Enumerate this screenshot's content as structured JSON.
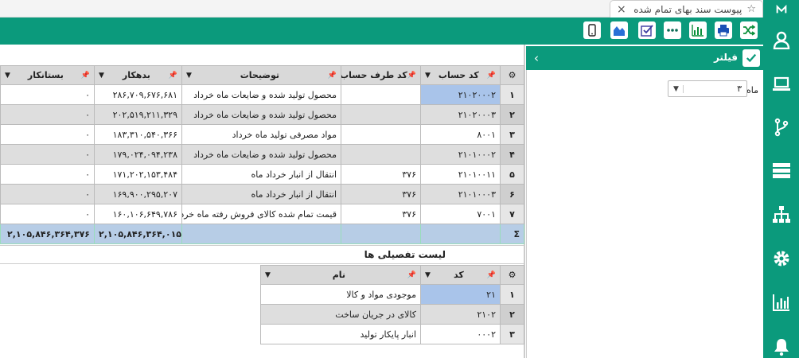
{
  "tab": {
    "title": "پیوست سند بهای تمام شده",
    "close": "×",
    "star": "☆"
  },
  "filter": {
    "title": "فیلتر",
    "chevron": "‹",
    "month_label": "ماه",
    "month_value": "۳"
  },
  "main_table": {
    "headers": {
      "account": "کد حساب",
      "counter": "کد طرف حساب",
      "desc": "توضیحات",
      "debit": "بدهکار",
      "credit": "بستانکار"
    },
    "rows": [
      {
        "idx": "۱",
        "account": "۲۱۰۲۰۰۰۲",
        "counter": "",
        "desc": "محصول تولید شده و ضایعات ماه خرداد",
        "debit": "۲۸۶,۷۰۹,۶۷۶,۶۸۱",
        "credit": "۰"
      },
      {
        "idx": "۲",
        "account": "۲۱۰۲۰۰۰۳",
        "counter": "",
        "desc": "محصول تولید شده و ضایعات ماه خرداد",
        "debit": "۲۰۲,۵۱۹,۲۱۱,۳۲۹",
        "credit": "۰"
      },
      {
        "idx": "۳",
        "account": "۸۰۰۱",
        "counter": "",
        "desc": "مواد مصرفی تولید ماه خرداد",
        "debit": "۱۸۳,۳۱۰,۵۴۰,۳۶۶",
        "credit": "۰"
      },
      {
        "idx": "۴",
        "account": "۲۱۰۱۰۰۰۲",
        "counter": "",
        "desc": "محصول تولید شده و ضایعات ماه خرداد",
        "debit": "۱۷۹,۰۲۴,۰۹۴,۲۳۸",
        "credit": "۰"
      },
      {
        "idx": "۵",
        "account": "۲۱۰۱۰۰۱۱",
        "counter": "۳۷۶",
        "desc": "انتقال از انبار خرداد ماه",
        "debit": "۱۷۱,۲۰۲,۱۵۳,۴۸۴",
        "credit": "۰"
      },
      {
        "idx": "۶",
        "account": "۲۱۰۱۰۰۰۳",
        "counter": "۳۷۶",
        "desc": "انتقال از انبار خرداد ماه",
        "debit": "۱۶۹,۹۰۰,۲۹۵,۲۰۷",
        "credit": "۰"
      },
      {
        "idx": "۷",
        "account": "۷۰۰۱",
        "counter": "۳۷۶",
        "desc": "قیمت تمام شده کالای فروش رفته ماه خرد",
        "debit": "۱۶۰,۱۰۶,۶۴۹,۷۸۶",
        "credit": "۰"
      }
    ],
    "sum": {
      "symbol": "Σ",
      "debit": "۲,۱۰۵,۸۴۶,۳۶۴,۰۱۵",
      "credit": "۲,۱۰۵,۸۴۶,۳۶۴,۳۷۶"
    }
  },
  "detail": {
    "title": "لیست تفصیلی ها",
    "headers": {
      "code": "کد",
      "name": "نام"
    },
    "rows": [
      {
        "idx": "۱",
        "code": "۲۱",
        "name": "موجودی مواد و کالا"
      },
      {
        "idx": "۲",
        "code": "۲۱۰۲",
        "name": "کالای در جریان ساخت"
      },
      {
        "idx": "۳",
        "code": "۰۰۰۲",
        "name": "انبار پایکار تولید"
      }
    ]
  },
  "icons": {
    "nav": [
      "logo-icon",
      "user-icon",
      "laptop-icon",
      "branch-icon",
      "server-icon",
      "sitemap-icon",
      "gear-icon",
      "bar-chart-icon",
      "bell-icon"
    ],
    "toolbar": [
      "shuffle-icon",
      "print-icon",
      "chart-icon",
      "more-icon",
      "check-square-icon",
      "area-chart-icon",
      "mobile-icon"
    ]
  },
  "colors": {
    "primary": "#0b9a7c",
    "selected": "#a9c4ea",
    "sum": "#b7cde6",
    "icon_blue": "#1a4fb5"
  }
}
